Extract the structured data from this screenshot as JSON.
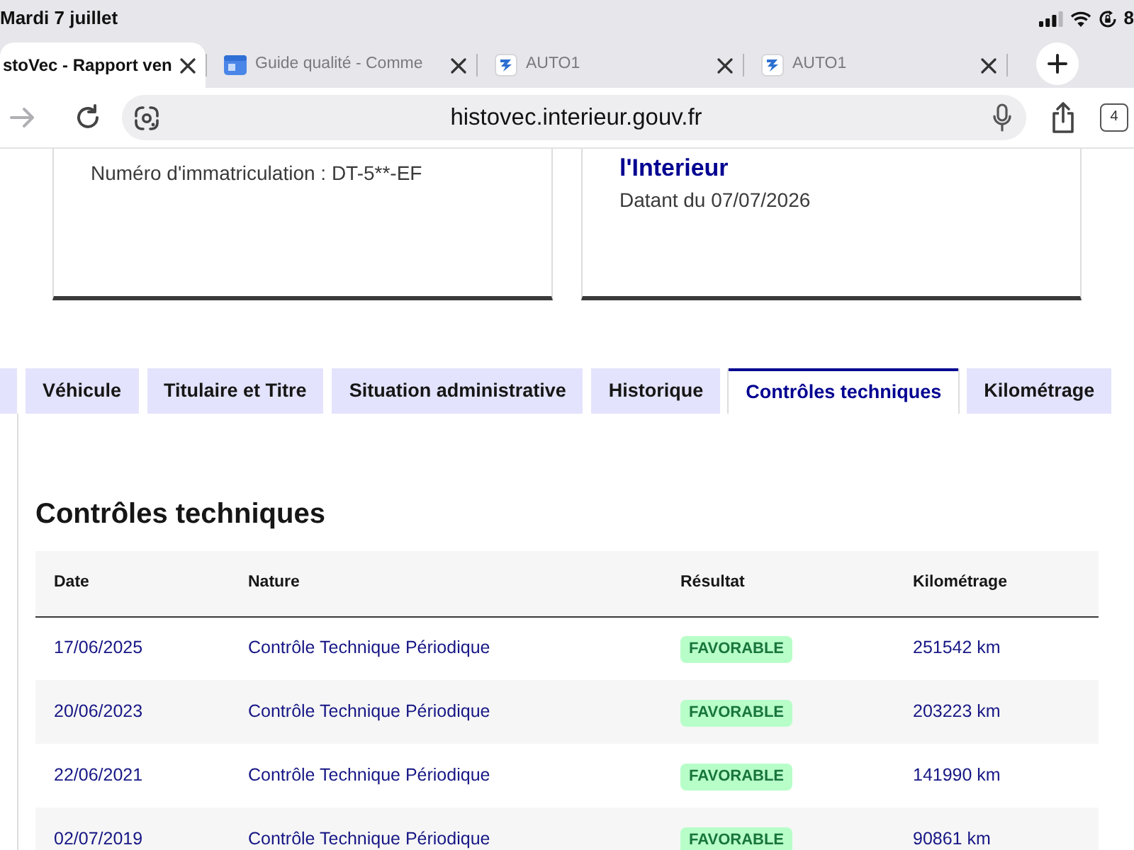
{
  "status_bar": {
    "date": "Mardi 7 juillet",
    "battery": "8"
  },
  "browser_tabs": [
    {
      "title": "stoVec - Rapport ven",
      "selected": true,
      "kind": "text"
    },
    {
      "title": "Guide qualité - Comme",
      "selected": false,
      "kind": "site"
    },
    {
      "title": "AUTO1",
      "selected": false,
      "kind": "logo"
    },
    {
      "title": "AUTO1",
      "selected": false,
      "kind": "logo"
    }
  ],
  "address_bar": {
    "url": "histovec.interieur.gouv.fr",
    "tab_count": "4",
    "forward_disabled": true
  },
  "cards": [
    {
      "text": "Numéro d'immatriculation : DT-5**-EF"
    },
    {
      "title": "l'Interieur",
      "text": "Datant du 07/07/2026"
    }
  ],
  "page_tabs": [
    {
      "selected": false
    },
    {
      "label": "Véhicule",
      "selected": false
    },
    {
      "label": "Titulaire et Titre",
      "selected": false
    },
    {
      "label": "Situation administrative",
      "selected": false
    },
    {
      "label": "Historique",
      "selected": false
    },
    {
      "label": "Contrôles techniques",
      "selected": true
    },
    {
      "label": "Kilométrage",
      "selected": false
    }
  ],
  "section": {
    "heading": "Contrôles techniques",
    "table": {
      "columns": [
        "Date",
        "Nature",
        "Résultat",
        "Kilométrage"
      ],
      "rows": [
        {
          "date": "17/06/2025",
          "nature": "Contrôle Technique Périodique",
          "result": "FAVORABLE",
          "mileage": "251542 km"
        },
        {
          "date": "20/06/2023",
          "nature": "Contrôle Technique Périodique",
          "result": "FAVORABLE",
          "mileage": "203223 km"
        },
        {
          "date": "22/06/2021",
          "nature": "Contrôle Technique Périodique",
          "result": "FAVORABLE",
          "mileage": "141990 km"
        },
        {
          "date": "02/07/2019",
          "nature": "Contrôle Technique Périodique",
          "result": "FAVORABLE",
          "mileage": "90861 km"
        }
      ]
    }
  }
}
